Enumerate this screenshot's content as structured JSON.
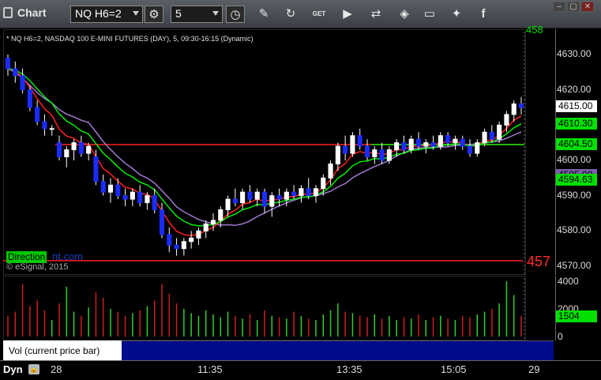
{
  "app": {
    "title": "Chart"
  },
  "toolbar": {
    "symbol_value": "NQ H6=2",
    "interval_value": "5",
    "icons": [
      "settings-gear-icon",
      "clock-icon",
      "pencil-icon",
      "refresh-icon",
      "get-icon",
      "play-icon",
      "link-icon",
      "message-icon",
      "twitter-icon",
      "facebook-icon"
    ],
    "get_label": "GET"
  },
  "chart": {
    "series_title": "* NQ H6=2, NASDAQ 100 E-MINI FUTURES (DAY), 5, 09:30-16:15 (Dynamic)",
    "copyright": "© eSignal, 2015",
    "direction_label": "Direction",
    "watermark_tail": "nt.com",
    "red_line_label": "457",
    "top_label": "458",
    "price_ticks": [
      "4630.00",
      "4620.00",
      "4610.00",
      "4600.00",
      "4590.00",
      "4580.00",
      "4570.00"
    ],
    "price_badges": [
      {
        "text": "4615.00",
        "bg": "#ffffff",
        "fg": "#000000"
      },
      {
        "text": "4610.30",
        "bg": "#00e000",
        "fg": "#000000"
      },
      {
        "text": "4604.50",
        "bg": "#00e000",
        "fg": "#000000"
      },
      {
        "text": "4595.00",
        "bg": "#7b5ea8",
        "fg": "#000000"
      },
      {
        "text": "4594.63",
        "bg": "#00e000",
        "fg": "#000000"
      }
    ],
    "volume_ticks": [
      "4000",
      "2000",
      "0"
    ],
    "volume_badge": "1504",
    "volume_label": "Vol (current price bar)",
    "time_ticks": [
      "28",
      "11:35",
      "13:35",
      "15:05",
      "29"
    ],
    "dyn_label": "Dyn",
    "colors": {
      "up": "#ffffff",
      "down": "#1a2cff",
      "ema_red": "#ff2020",
      "ema_green": "#00ee00",
      "ma_purple": "#a07ad0",
      "vol_up": "#33cc33",
      "vol_down": "#cc2020"
    }
  },
  "chart_data": {
    "type": "candlestick",
    "ylim": [
      4570,
      4635
    ],
    "candles": [
      [
        4629,
        4630,
        4624,
        4626
      ],
      [
        4626,
        4628,
        4622,
        4624
      ],
      [
        4624,
        4626,
        4619,
        4620
      ],
      [
        4620,
        4621,
        4614,
        4615
      ],
      [
        4615,
        4617,
        4610,
        4611
      ],
      [
        4611,
        4613,
        4607,
        4609
      ],
      [
        4609,
        4610,
        4607,
        4609
      ],
      [
        4605,
        4607,
        4600,
        4601
      ],
      [
        4601,
        4604,
        4598,
        4603
      ],
      [
        4603,
        4606,
        4600,
        4605
      ],
      [
        4605,
        4607,
        4601,
        4602
      ],
      [
        4602,
        4605,
        4600,
        4604
      ],
      [
        4601,
        4603,
        4593,
        4594
      ],
      [
        4594,
        4596,
        4590,
        4591
      ],
      [
        4591,
        4595,
        4588,
        4593
      ],
      [
        4593,
        4595,
        4589,
        4590
      ],
      [
        4590,
        4592,
        4587,
        4589
      ],
      [
        4589,
        4592,
        4587,
        4591
      ],
      [
        4591,
        4593,
        4587,
        4588
      ],
      [
        4588,
        4591,
        4586,
        4590
      ],
      [
        4590,
        4592,
        4585,
        4586
      ],
      [
        4586,
        4588,
        4578,
        4579
      ],
      [
        4579,
        4581,
        4574,
        4576
      ],
      [
        4576,
        4578,
        4573,
        4575
      ],
      [
        4575,
        4578,
        4573,
        4577
      ],
      [
        4577,
        4580,
        4575,
        4578
      ],
      [
        4578,
        4581,
        4576,
        4580
      ],
      [
        4580,
        4583,
        4578,
        4582
      ],
      [
        4582,
        4585,
        4580,
        4583
      ],
      [
        4583,
        4587,
        4581,
        4586
      ],
      [
        4586,
        4590,
        4584,
        4589
      ],
      [
        4589,
        4592,
        4587,
        4588
      ],
      [
        4588,
        4592,
        4586,
        4591
      ],
      [
        4591,
        4593,
        4588,
        4589
      ],
      [
        4589,
        4592,
        4587,
        4591
      ],
      [
        4591,
        4592,
        4585,
        4587
      ],
      [
        4587,
        4591,
        4584,
        4590
      ],
      [
        4590,
        4592,
        4587,
        4589
      ],
      [
        4589,
        4592,
        4587,
        4591
      ],
      [
        4591,
        4593,
        4589,
        4590
      ],
      [
        4590,
        4593,
        4588,
        4592
      ],
      [
        4592,
        4595,
        4589,
        4590
      ],
      [
        4590,
        4593,
        4588,
        4592
      ],
      [
        4592,
        4596,
        4590,
        4595
      ],
      [
        4595,
        4600,
        4593,
        4599
      ],
      [
        4599,
        4605,
        4597,
        4604
      ],
      [
        4604,
        4607,
        4600,
        4602
      ],
      [
        4602,
        4608,
        4601,
        4607
      ],
      [
        4607,
        4609,
        4603,
        4604
      ],
      [
        4604,
        4606,
        4600,
        4601
      ],
      [
        4601,
        4604,
        4599,
        4603
      ],
      [
        4603,
        4605,
        4599,
        4600
      ],
      [
        4600,
        4604,
        4599,
        4603
      ],
      [
        4603,
        4606,
        4601,
        4605
      ],
      [
        4605,
        4607,
        4602,
        4603
      ],
      [
        4603,
        4607,
        4602,
        4606
      ],
      [
        4606,
        4608,
        4603,
        4604
      ],
      [
        4604,
        4606,
        4602,
        4605
      ],
      [
        4605,
        4607,
        4603,
        4604
      ],
      [
        4604,
        4608,
        4603,
        4607
      ],
      [
        4607,
        4608,
        4604,
        4605
      ],
      [
        4605,
        4607,
        4603,
        4606
      ],
      [
        4606,
        4607,
        4603,
        4604
      ],
      [
        4604,
        4606,
        4601,
        4602
      ],
      [
        4602,
        4606,
        4601,
        4605
      ],
      [
        4605,
        4609,
        4604,
        4608
      ],
      [
        4608,
        4610,
        4605,
        4606
      ],
      [
        4606,
        4611,
        4605,
        4610
      ],
      [
        4610,
        4614,
        4608,
        4613
      ],
      [
        4613,
        4617,
        4611,
        4616
      ],
      [
        4616,
        4618,
        4613,
        4615
      ]
    ],
    "volume": [
      1500,
      1800,
      3800,
      2200,
      2600,
      1900,
      1200,
      2400,
      3600,
      1800,
      1500,
      2100,
      3200,
      2800,
      2000,
      1800,
      1500,
      1700,
      1900,
      2200,
      2600,
      3800,
      3100,
      2400,
      2000,
      1700,
      1500,
      1900,
      1600,
      1400,
      1800,
      1500,
      1300,
      1600,
      1200,
      1900,
      1500,
      1400,
      1300,
      1800,
      1500,
      1300,
      1200,
      1600,
      1900,
      2400,
      1800,
      1700,
      1500,
      1400,
      1600,
      1300,
      1500,
      1200,
      1400,
      1300,
      1600,
      1200,
      1400,
      1500,
      1300,
      1200,
      1500,
      1400,
      1600,
      1800,
      2000,
      2400,
      4000,
      3000,
      1500
    ]
  }
}
